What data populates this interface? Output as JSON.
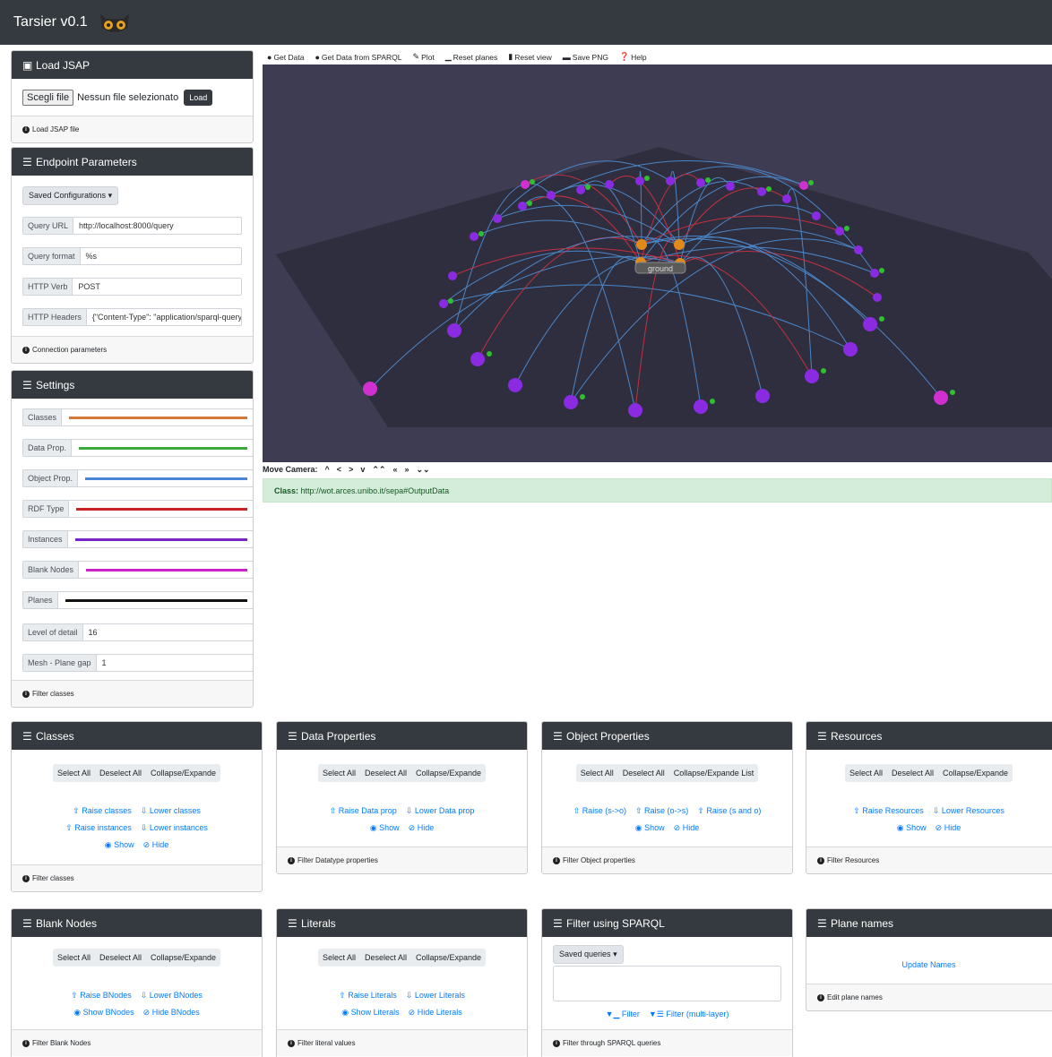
{
  "navbar": {
    "title": "Tarsier v0.1"
  },
  "load_jsap": {
    "title": "Load JSAP",
    "choose_file": "Scegli file",
    "no_file": "Nessun file selezionato",
    "load_button": "Load",
    "footer": "Load JSAP file"
  },
  "endpoint": {
    "title": "Endpoint Parameters",
    "saved_configs": "Saved Configurations",
    "fields": [
      {
        "label": "Query URL",
        "value": "http://localhost:8000/query"
      },
      {
        "label": "Query format",
        "value": "%s"
      },
      {
        "label": "HTTP Verb",
        "value": "POST"
      },
      {
        "label": "HTTP Headers",
        "value": "{\"Content-Type\": \"application/sparql-query\","
      }
    ],
    "footer": "Connection parameters"
  },
  "settings": {
    "title": "Settings",
    "colors": [
      {
        "label": "Classes",
        "color": "#d4783a"
      },
      {
        "label": "Data Prop.",
        "color": "#3aaa3a"
      },
      {
        "label": "Object Prop.",
        "color": "#4a86d8"
      },
      {
        "label": "RDF Type",
        "color": "#cc2222"
      },
      {
        "label": "Instances",
        "color": "#7a22cc"
      },
      {
        "label": "Blank Nodes",
        "color": "#cc22cc"
      },
      {
        "label": "Planes",
        "color": "#111111"
      }
    ],
    "level_of_detail": {
      "label": "Level of detail",
      "value": "16"
    },
    "mesh_gap": {
      "label": "Mesh - Plane gap",
      "value": "1"
    },
    "footer": "Filter classes"
  },
  "toolbar": {
    "get_data": "Get Data",
    "get_sparql": "Get Data from SPARQL",
    "plot": "Plot",
    "reset_planes": "Reset planes",
    "reset_view": "Reset view",
    "save_png": "Save PNG",
    "help": "Help"
  },
  "viz": {
    "ground_label": "ground"
  },
  "camera": {
    "label": "Move Camera:",
    "buttons": [
      "^",
      "<",
      ">",
      "v",
      "⌃⌃",
      "«",
      "»",
      "⌄⌄"
    ]
  },
  "alert": {
    "prefix": "Class:",
    "value": "http://wot.arces.unibo.it/sepa#OutputData"
  },
  "panels": {
    "classes": {
      "title": "Classes",
      "select_all": "Select All",
      "deselect_all": "Deselect All",
      "collapse": "Collapse/Expande",
      "raise": "Raise classes",
      "lower": "Lower classes",
      "raise2": "Raise instances",
      "lower2": "Lower instances",
      "show": "Show",
      "hide": "Hide",
      "footer": "Filter classes"
    },
    "data_props": {
      "title": "Data Properties",
      "select_all": "Select All",
      "deselect_all": "Deselect All",
      "collapse": "Collapse/Expande",
      "raise": "Raise Data prop",
      "lower": "Lower Data prop",
      "show": "Show",
      "hide": "Hide",
      "footer": "Filter Datatype properties"
    },
    "object_props": {
      "title": "Object Properties",
      "select_all": "Select All",
      "deselect_all": "Deselect All",
      "collapse": "Collapse/Expande List",
      "raise1": "Raise (s->o)",
      "raise2": "Raise (o->s)",
      "raise3": "Raise (s and o)",
      "show": "Show",
      "hide": "Hide",
      "footer": "Filter Object properties"
    },
    "resources": {
      "title": "Resources",
      "select_all": "Select All",
      "deselect_all": "Deselect All",
      "collapse": "Collapse/Expande",
      "raise": "Raise Resources",
      "lower": "Lower Resources",
      "show": "Show",
      "hide": "Hide",
      "footer": "Filter Resources"
    },
    "bnodes": {
      "title": "Blank Nodes",
      "select_all": "Select All",
      "deselect_all": "Deselect All",
      "collapse": "Collapse/Expande",
      "raise": "Raise BNodes",
      "lower": "Lower BNodes",
      "show": "Show BNodes",
      "hide": "Hide BNodes",
      "footer": "Filter Blank Nodes"
    },
    "literals": {
      "title": "Literals",
      "select_all": "Select All",
      "deselect_all": "Deselect All",
      "collapse": "Collapse/Expande",
      "raise": "Raise Literals",
      "lower": "Lower Literals",
      "show": "Show Literals",
      "hide": "Hide Literals",
      "footer": "Filter literal values"
    },
    "sparql_filter": {
      "title": "Filter using SPARQL",
      "saved_queries": "Saved queries",
      "filter": "Filter",
      "filter_multi": "Filter (multi-layer)",
      "footer": "Filter through SPARQL queries"
    },
    "plane_names": {
      "title": "Plane names",
      "update": "Update Names",
      "footer": "Edit plane names"
    }
  }
}
